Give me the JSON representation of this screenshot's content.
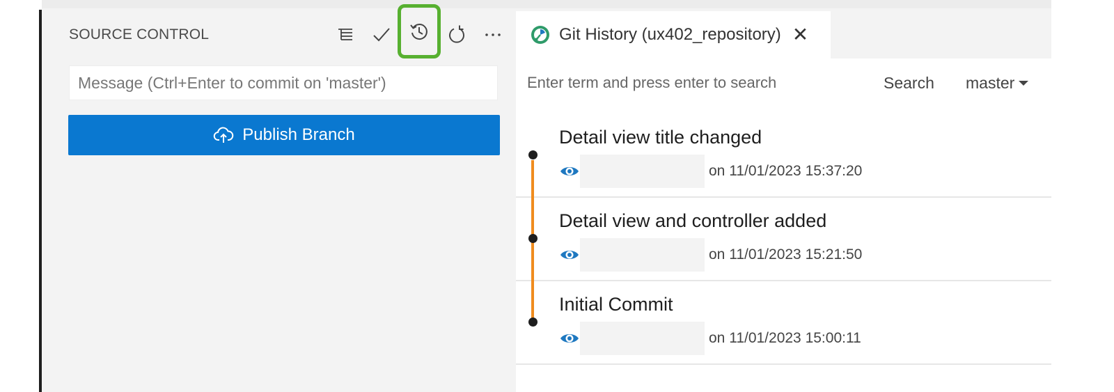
{
  "source_control": {
    "title": "SOURCE CONTROL",
    "toolbar": [
      {
        "name": "view-as-tree-icon",
        "highlight": false
      },
      {
        "name": "commit-check-icon",
        "highlight": false
      },
      {
        "name": "history-icon",
        "highlight": true
      },
      {
        "name": "refresh-icon",
        "highlight": false
      },
      {
        "name": "more-actions-icon",
        "highlight": false
      }
    ],
    "message_placeholder": "Message (Ctrl+Enter to commit on 'master')",
    "publish_label": "Publish Branch"
  },
  "git_history": {
    "tab_label": "Git History (ux402_repository)",
    "close_glyph": "✕",
    "search_placeholder": "Enter term and press enter to search",
    "search_label": "Search",
    "branch": "master",
    "commits": [
      {
        "message": "Detail view title changed",
        "date": "on 11/01/2023 15:37:20"
      },
      {
        "message": "Detail view and controller added",
        "date": "on 11/01/2023 15:21:50"
      },
      {
        "message": "Initial Commit",
        "date": "on 11/01/2023 15:00:11"
      }
    ]
  },
  "colors": {
    "accent_blue": "#0a78d0",
    "highlight_green": "#57b030",
    "graph_orange": "#f08c1e",
    "eye_blue": "#1e78c0"
  }
}
